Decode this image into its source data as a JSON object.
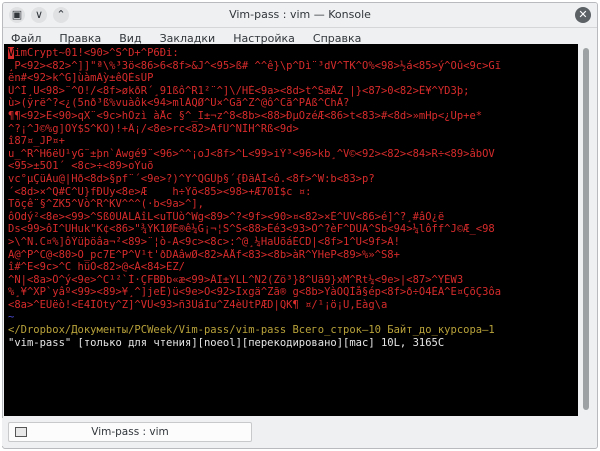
{
  "window": {
    "title": "Vim-pass : vim — Konsole",
    "buttons": {
      "app": "▣",
      "collapse": "∨",
      "pin": "⌃",
      "close": "✕"
    }
  },
  "menu": [
    "Файл",
    "Правка",
    "Вид",
    "Закладки",
    "Настройка",
    "Справка"
  ],
  "terminal": {
    "cursor_char": "V",
    "first_line_rest": "imCrypt~01!<90>^S^D+^P6Ði:",
    "lines": [
      "¸P<92><82>^]]\"ª\\%³3ö<86>6<8f>&J^<95>ß# ^^ê}\\p^Dì¨³dV^TK^O%<98>½á<85>ý^Oû<9c>Gĩ",
      "ën#<92>k^G]ùàmÄỳ±êQÈsÚP",
      "Û^Ì¸U<98>¨^O!/<8f>økðR´¸91ßô^R1²¨^]\\/HÈ<9a><8d>t^SæÂZ |}<87>0<82>Ê¥^YD3þ;",
      "ù>(ÿrë^?<¿(5nð³ß%vuàôk<94>mlÁQØ^U×^Gã^Z^@ô^Cã^PÀß^ChÀ?",
      "¶¶<92>Ë<90>qX¨<9c>hÔzì àÅc §^_I±¬z^8<8b><88>ÐµÕzéÆ<86>t<83>#<8d>»mHp<¿Ùp+e*",
      "^?¡^J©%g]ÖÝ$S^KÔ)!+Â¡/<8e>rc<82>AfÙ^NÌH^Rß<9d>",
      "î87¤_JP¤+",
      "u_^R^H6ëÙ¹yG¨±þn`Àwgé9¨<96>^^¡oJ<8f>^L<99>iÝ³<96>kb¸^V©<92><82><84>R÷<89>âbÕV",
      "<95>±5Ö1´ <8c>÷<89>oÝuõ",
      "vc°µÇüÀu@|Hð<8d>§pf¨´<9e>?)^Y^QGÜþ§´{ÐäÀÌ<ô.<8f>^W:b<83>p?",
      "´<8d>×^Q#C^U}fÐÜy<8e>Æ    h÷Ýõ<85><98>+Æ70Î$c ¤:",
      "Tõçê¨§^ZK5^Vò^R^KV^^^(·b<9a>^],",
      "ôOdý²<8e><99>^Sß0ÜÀLÄîL<uTÜò^Wg<89>^?<9f><90>¤<82>×É^UV<86>é]^?¸#âÒ¿ë",
      "Ds<99>ôI^UHuk\"K¢<86>\"¾ÝK1ØÉ®ê¼G¡¬¦S^S<88>Éé3<93>Ò^?èF^DÜÄ^Sb<94>¼lôff^J©Æ_<98",
      ">\\^N.C¤%]ôÝüþöâa¬²<89>¨¦ò-A<9c><8c>:^@¸¼HaÜõáÉCD|<8f>1^U<9f>Ä!",
      "Ä@^P^C@<80>O_pc7E^P^V¹t'ðDÄâwØ<82>ÂÅf<83><8b>àR^YHeP<89>%»^S8+",
      "î#^E<9c>^C hüÒ<82>@<Á<84>ÉZ/",
      "^N|<8a>Ô^ý<9e>^C¹²`Ì·ÇFBÐb«æ<99>ÂÏ±YLL^N2(Zö³}8^Uä9}xM^Rt¼<9e>|<87>^YÈW3",
      "%¸¥^XP`yâº<99><89>¥¸^]jeÊ)ü<9e>Ö<92>Ïxgä^Zã® g<8b>YàÕQÌå§ép<8f>ð÷Ô4ÈÄ^E¤ÇõÇ3ôa",
      "<8a>^EÜëò!<E4ÏÖty^Z]^VÛ<93>ñ3ÙáIu^Z4èÙtPÆD|QK¶ ¤/¹¡ö¡U,Eàg\\a"
    ],
    "tilde": "~",
    "status_line": "</Dropbox/Документы/PCWeek/Vim-pass/vim-pass Всего_строк—10 Байт_до_курсора—1",
    "message_line": "\"vim-pass\" [только для чтения][noeol][перекодировано][mac] 10L, 3165C"
  },
  "tab": {
    "label": "Vim-pass : vim"
  }
}
